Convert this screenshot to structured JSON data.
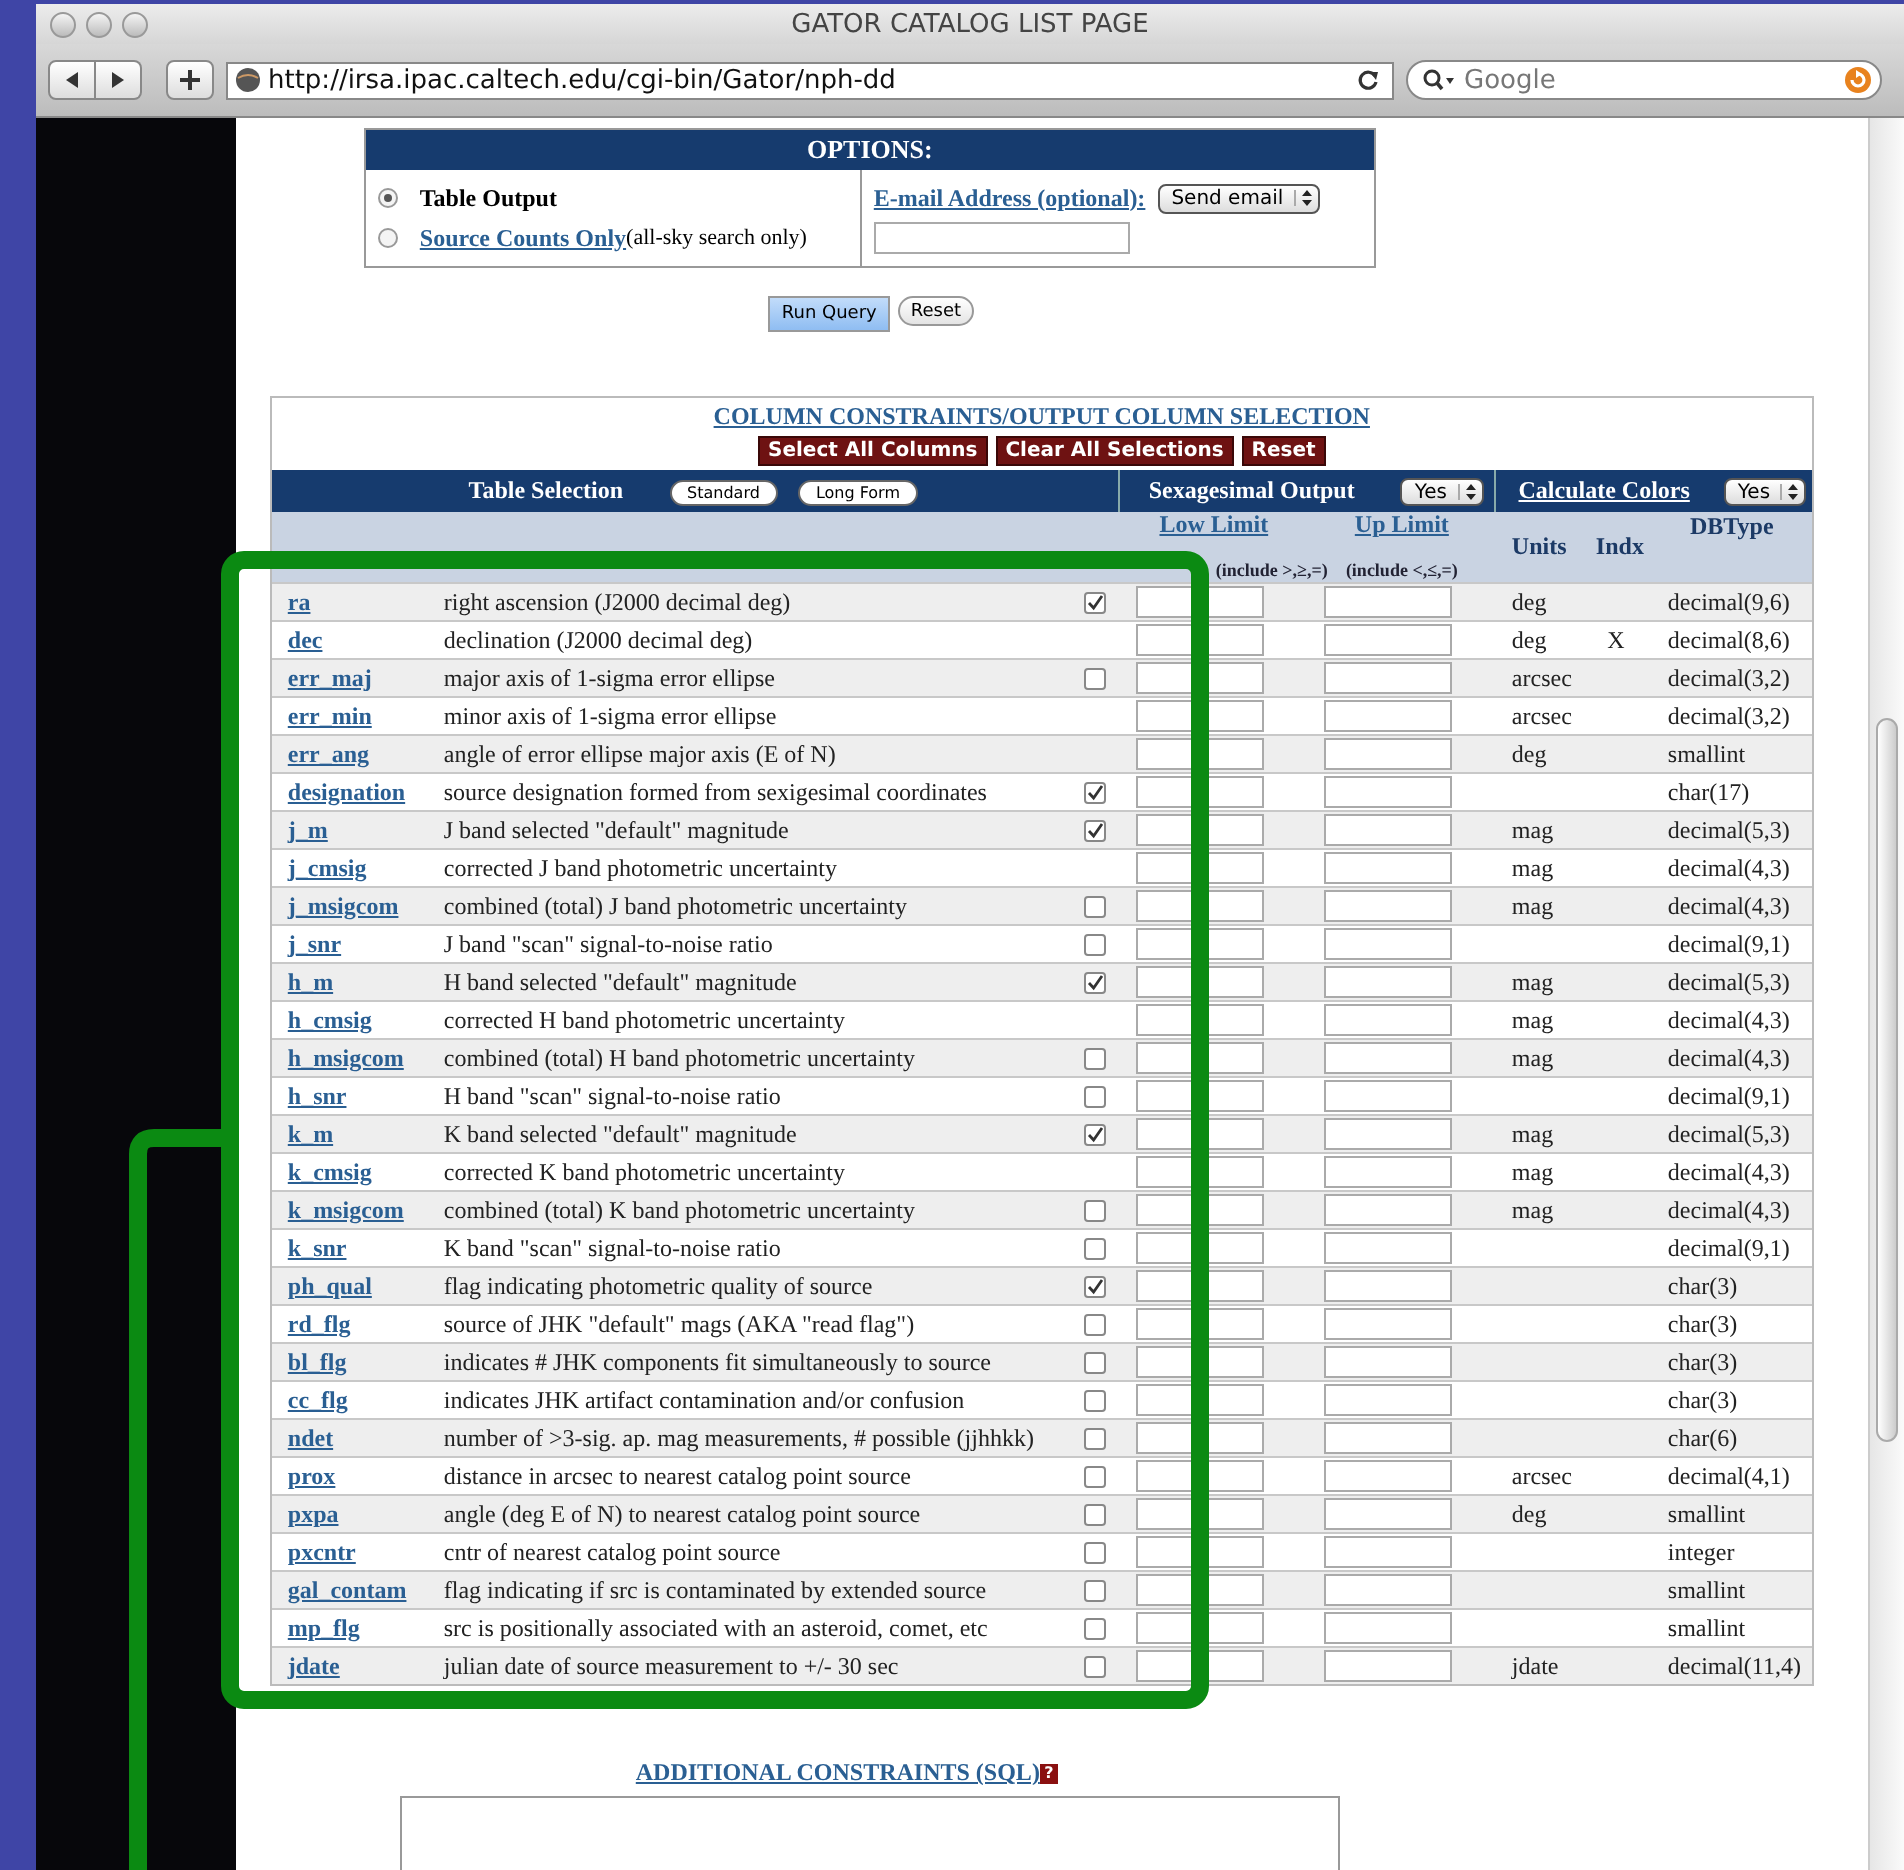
{
  "browser": {
    "title": "GATOR CATALOG LIST PAGE",
    "url": "http://irsa.ipac.caltech.edu/cgi-bin/Gator/nph-dd",
    "search_placeholder": "Google"
  },
  "options": {
    "title": "OPTIONS:",
    "output_modes": [
      {
        "label": "Table Output",
        "kind": "plain",
        "selected": true
      },
      {
        "label": "Source Counts Only",
        "note": "(all-sky search only)",
        "kind": "link",
        "selected": false
      }
    ],
    "email_label": "E-mail Address (optional):",
    "email_select": "Send email"
  },
  "query_buttons": [
    {
      "label": "Run Query",
      "kind": "default"
    },
    {
      "label": "Reset",
      "kind": "normal"
    }
  ],
  "constraints": {
    "title": "COLUMN CONSTRAINTS/OUTPUT COLUMN SELECTION",
    "actions": [
      "Select All Columns",
      "Clear All Selections",
      "Reset"
    ],
    "table_selection_label": "Table Selection",
    "view_buttons": [
      "Standard",
      "Long Form"
    ],
    "sexagesimal_label": "Sexagesimal Output",
    "sexagesimal_value": "Yes",
    "colors_label": "Calculate Colors",
    "colors_value": "Yes",
    "low_label": "Low Limit",
    "low_note": "(include >,≥,=)",
    "up_label": "Up Limit",
    "up_note": "(include <,≤,=)",
    "units_header": "Units",
    "indx_header": "Indx",
    "dbtype_header": "DBType",
    "rows": [
      {
        "name": "ra",
        "description": "right ascension (J2000 decimal deg)",
        "kind": "checkbox",
        "checked": true,
        "units": "deg",
        "dbtype": "decimal(9,6)"
      },
      {
        "name": "dec",
        "description": "declination (J2000 decimal deg)",
        "kind": "fixed",
        "units": "deg",
        "indx": "X",
        "dbtype": "decimal(8,6)"
      },
      {
        "name": "err_maj",
        "description": "major axis of 1-sigma error ellipse",
        "kind": "checkbox",
        "checked": false,
        "units": "arcsec",
        "dbtype": "decimal(3,2)"
      },
      {
        "name": "err_min",
        "description": "minor axis of 1-sigma error ellipse",
        "kind": "fixed",
        "units": "arcsec",
        "dbtype": "decimal(3,2)"
      },
      {
        "name": "err_ang",
        "description": "angle of error ellipse major axis (E of N)",
        "kind": "fixed",
        "units": "deg",
        "dbtype": "smallint"
      },
      {
        "name": "designation",
        "description": "source designation formed from sexigesimal coordinates",
        "kind": "checkbox",
        "checked": true,
        "dbtype": "char(17)"
      },
      {
        "name": "j_m",
        "description": "J band selected \"default\" magnitude",
        "kind": "checkbox",
        "checked": true,
        "units": "mag",
        "dbtype": "decimal(5,3)"
      },
      {
        "name": "j_cmsig",
        "description": "corrected J band photometric uncertainty",
        "kind": "fixed",
        "units": "mag",
        "dbtype": "decimal(4,3)"
      },
      {
        "name": "j_msigcom",
        "description": "combined (total) J band photometric uncertainty",
        "kind": "checkbox",
        "checked": false,
        "units": "mag",
        "dbtype": "decimal(4,3)"
      },
      {
        "name": "j_snr",
        "description": "J band \"scan\" signal-to-noise ratio",
        "kind": "checkbox",
        "checked": false,
        "dbtype": "decimal(9,1)"
      },
      {
        "name": "h_m",
        "description": "H band selected \"default\" magnitude",
        "kind": "checkbox",
        "checked": true,
        "units": "mag",
        "dbtype": "decimal(5,3)"
      },
      {
        "name": "h_cmsig",
        "description": "corrected H band photometric uncertainty",
        "kind": "fixed",
        "units": "mag",
        "dbtype": "decimal(4,3)"
      },
      {
        "name": "h_msigcom",
        "description": "combined (total) H band photometric uncertainty",
        "kind": "checkbox",
        "checked": false,
        "units": "mag",
        "dbtype": "decimal(4,3)"
      },
      {
        "name": "h_snr",
        "description": "H band \"scan\" signal-to-noise ratio",
        "kind": "checkbox",
        "checked": false,
        "dbtype": "decimal(9,1)"
      },
      {
        "name": "k_m",
        "description": "K band selected \"default\" magnitude",
        "kind": "checkbox",
        "checked": true,
        "units": "mag",
        "dbtype": "decimal(5,3)"
      },
      {
        "name": "k_cmsig",
        "description": "corrected K band photometric uncertainty",
        "kind": "fixed",
        "units": "mag",
        "dbtype": "decimal(4,3)"
      },
      {
        "name": "k_msigcom",
        "description": "combined (total) K band photometric uncertainty",
        "kind": "checkbox",
        "checked": false,
        "units": "mag",
        "dbtype": "decimal(4,3)"
      },
      {
        "name": "k_snr",
        "description": "K band \"scan\" signal-to-noise ratio",
        "kind": "checkbox",
        "checked": false,
        "dbtype": "decimal(9,1)"
      },
      {
        "name": "ph_qual",
        "description": "flag indicating photometric quality of source",
        "kind": "checkbox",
        "checked": true,
        "dbtype": "char(3)"
      },
      {
        "name": "rd_flg",
        "description": "source of JHK \"default\" mags (AKA \"read flag\")",
        "kind": "checkbox",
        "checked": false,
        "dbtype": "char(3)"
      },
      {
        "name": "bl_flg",
        "description": "indicates # JHK components fit simultaneously to source",
        "kind": "checkbox",
        "checked": false,
        "dbtype": "char(3)"
      },
      {
        "name": "cc_flg",
        "description": "indicates JHK artifact contamination and/or confusion",
        "kind": "checkbox",
        "checked": false,
        "dbtype": "char(3)"
      },
      {
        "name": "ndet",
        "description": "number of >3-sig. ap. mag measurements, # possible (jjhhkk)",
        "kind": "checkbox",
        "checked": false,
        "dbtype": "char(6)"
      },
      {
        "name": "prox",
        "description": "distance in arcsec to nearest catalog point source",
        "kind": "checkbox",
        "checked": false,
        "units": "arcsec",
        "dbtype": "decimal(4,1)"
      },
      {
        "name": "pxpa",
        "description": "angle (deg E of N) to nearest catalog point source",
        "kind": "checkbox",
        "checked": false,
        "units": "deg",
        "dbtype": "smallint"
      },
      {
        "name": "pxcntr",
        "description": "cntr of nearest catalog point source",
        "kind": "checkbox",
        "checked": false,
        "dbtype": "integer"
      },
      {
        "name": "gal_contam",
        "description": "flag indicating if src is contaminated by extended source",
        "kind": "checkbox",
        "checked": false,
        "dbtype": "smallint"
      },
      {
        "name": "mp_flg",
        "description": "src is positionally associated with an asteroid, comet, etc",
        "kind": "checkbox",
        "checked": false,
        "dbtype": "smallint"
      },
      {
        "name": "jdate",
        "description": "julian date of source measurement to +/- 30 sec",
        "kind": "checkbox",
        "checked": false,
        "units": "jdate",
        "dbtype": "decimal(11,4)"
      }
    ]
  },
  "additional_constraints": {
    "title": "ADDITIONAL CONSTRAINTS (SQL)",
    "help": "?"
  }
}
